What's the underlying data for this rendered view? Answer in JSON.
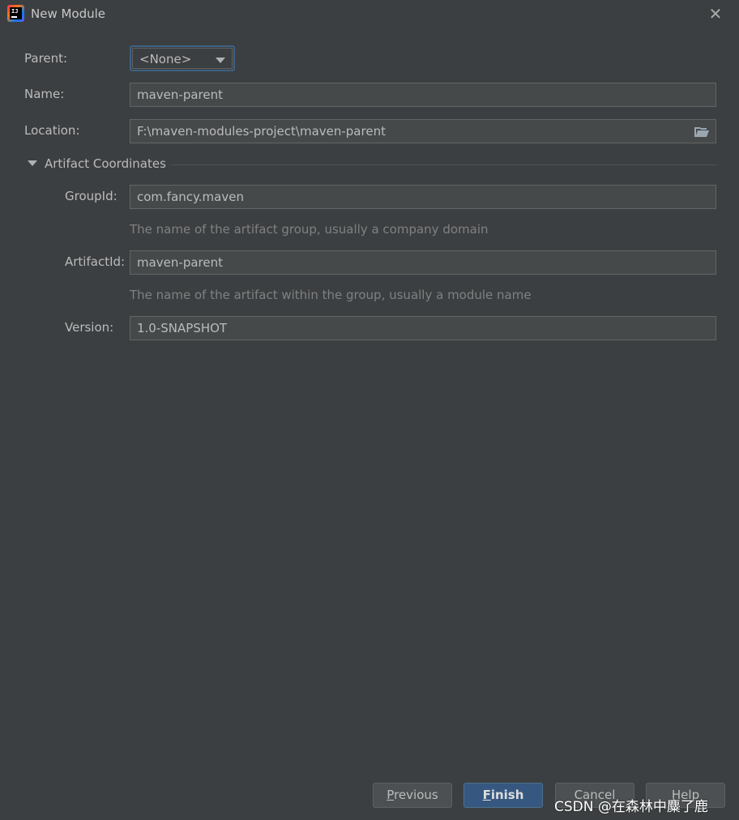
{
  "window": {
    "title": "New Module",
    "close_symbol": "✕"
  },
  "form": {
    "parent_label": "Parent:",
    "parent_value": "<None>",
    "name_label": "Name:",
    "name_value": "maven-parent",
    "location_label": "Location:",
    "location_value": "F:\\maven-modules-project\\maven-parent"
  },
  "artifact_section": {
    "title": "Artifact Coordinates",
    "groupid_label": "GroupId:",
    "groupid_value": "com.fancy.maven",
    "groupid_hint": "The name of the artifact group, usually a company domain",
    "artifactid_label": "ArtifactId:",
    "artifactid_value": "maven-parent",
    "artifactid_hint": "The name of the artifact within the group, usually a module name",
    "version_label": "Version:",
    "version_value": "1.0-SNAPSHOT"
  },
  "buttons": {
    "previous_mnemonic": "P",
    "previous_rest": "revious",
    "finish_mnemonic": "F",
    "finish_rest": "inish",
    "cancel": "Cancel",
    "help": "Help"
  },
  "watermark": "CSDN @在森林中麋了鹿",
  "colors": {
    "background": "#3c3f41",
    "field_bg": "#45494a",
    "accent": "#365880",
    "focus_border": "#3d6185"
  },
  "icons": [
    "app-icon",
    "close-icon",
    "chevron-down-icon",
    "folder-icon",
    "collapse-triangle-icon"
  ]
}
